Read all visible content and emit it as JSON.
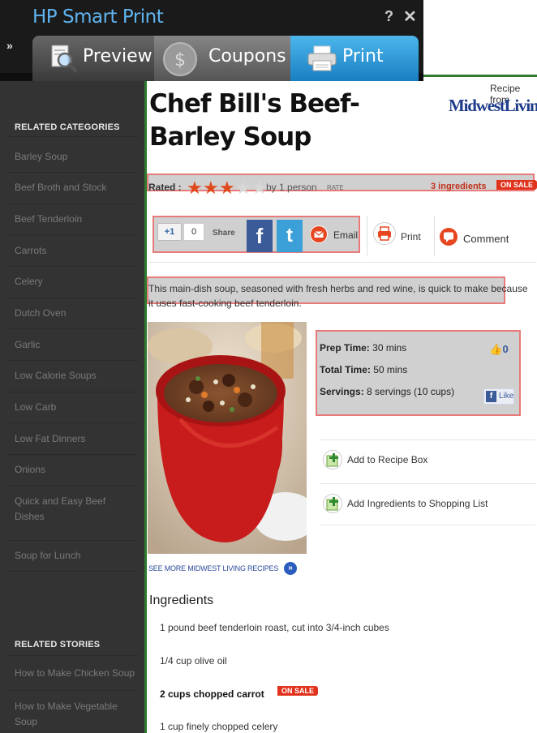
{
  "toolbar": {
    "title": "HP Smart Print",
    "help": "?",
    "close": "✕",
    "expand": "»",
    "tabs": [
      {
        "label": "Preview",
        "icon": "magnifier-icon"
      },
      {
        "label": "Coupons",
        "icon": "dollar-coin-icon"
      },
      {
        "label": "Print",
        "icon": "printer-icon",
        "active": true
      }
    ],
    "colors": {
      "title": "#5fb4f0",
      "active_tab": "#2a96d8"
    }
  },
  "sidebar": {
    "categories_heading": "RELATED CATEGORIES",
    "categories": [
      "Barley Soup",
      "Beef Broth and Stock",
      "Beef Tenderloin",
      "Carrots",
      "Celery",
      "Dutch Oven",
      "Garlic",
      "Low Calorie Soups",
      "Low Carb",
      "Low Fat Dinners",
      "Onions",
      "Quick and Easy Beef Dishes",
      "Soup for Lunch"
    ],
    "stories_heading": "RELATED STORIES",
    "stories": [
      "How to Make Chicken Soup",
      "How to Make Vegetable Soup"
    ]
  },
  "recipe": {
    "title": "Chef Bill's Beef-Barley Soup",
    "recipe_from": "Recipe from",
    "brand": "MidwestLiving.",
    "rated_label": "Rated :",
    "rating": 3,
    "rating_max": 5,
    "rated_by": "by 1 person",
    "rate_link": "RATE",
    "ingredients_count": "3 ingredients",
    "on_sale": "ON SALE",
    "social": {
      "plus_one": "+1",
      "plus_one_count": "0",
      "share": "Share",
      "facebook": "f",
      "twitter": "t",
      "email": "Email",
      "print": "Print",
      "comment": "Comment"
    },
    "description": "This main-dish soup, seasoned with fresh herbs and red wine, is quick to make because it uses fast-cooking beef tenderloin.",
    "prep_time_label": "Prep Time:",
    "prep_time": "30 mins",
    "total_time_label": "Total Time:",
    "total_time": "50 mins",
    "servings_label": "Servings:",
    "servings": "8 servings (10 cups)",
    "like_count": "0",
    "like_label": "Like",
    "add_to_box": "Add to Recipe Box",
    "add_to_list": "Add Ingredients to Shopping List",
    "see_more": "SEE MORE MIDWEST LIVING RECIPES",
    "ingredients_heading": "Ingredients",
    "ingredients": [
      {
        "text": "1 pound  beef tenderloin roast, cut into 3/4-inch cubes",
        "on_sale": false
      },
      {
        "text": "1/4 cup  olive oil",
        "on_sale": false
      },
      {
        "text": "2 cups  chopped carrot",
        "on_sale": true
      },
      {
        "text": "1 cup  finely chopped celery",
        "on_sale": false
      }
    ],
    "colors": {
      "accent_red": "#e0331e",
      "link_blue": "#2a4a9a",
      "highlight_border": "#e87a7a"
    }
  }
}
